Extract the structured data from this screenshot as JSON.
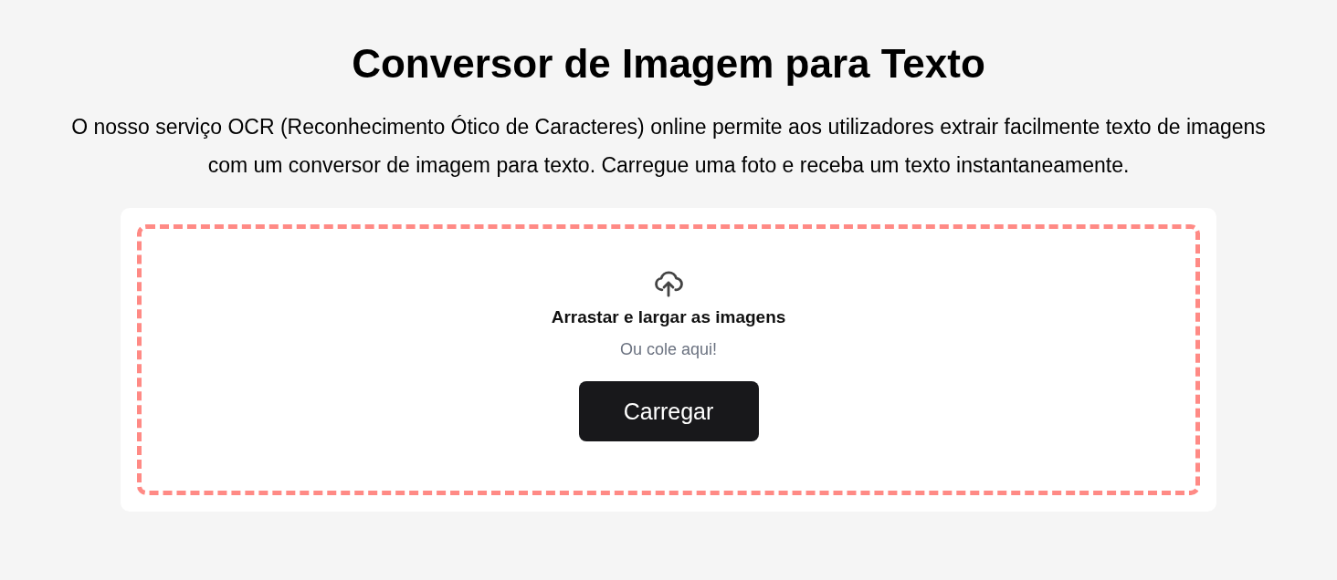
{
  "title": "Conversor de Imagem para Texto",
  "description": "O nosso serviço OCR (Reconhecimento Ótico de Caracteres) online permite aos utilizadores extrair facilmente texto de imagens com um conversor de imagem para texto. Carregue uma foto e receba um texto instantaneamente.",
  "dropzone": {
    "heading": "Arrastar e largar as imagens",
    "hint": "Ou cole aqui!",
    "button": "Carregar"
  }
}
